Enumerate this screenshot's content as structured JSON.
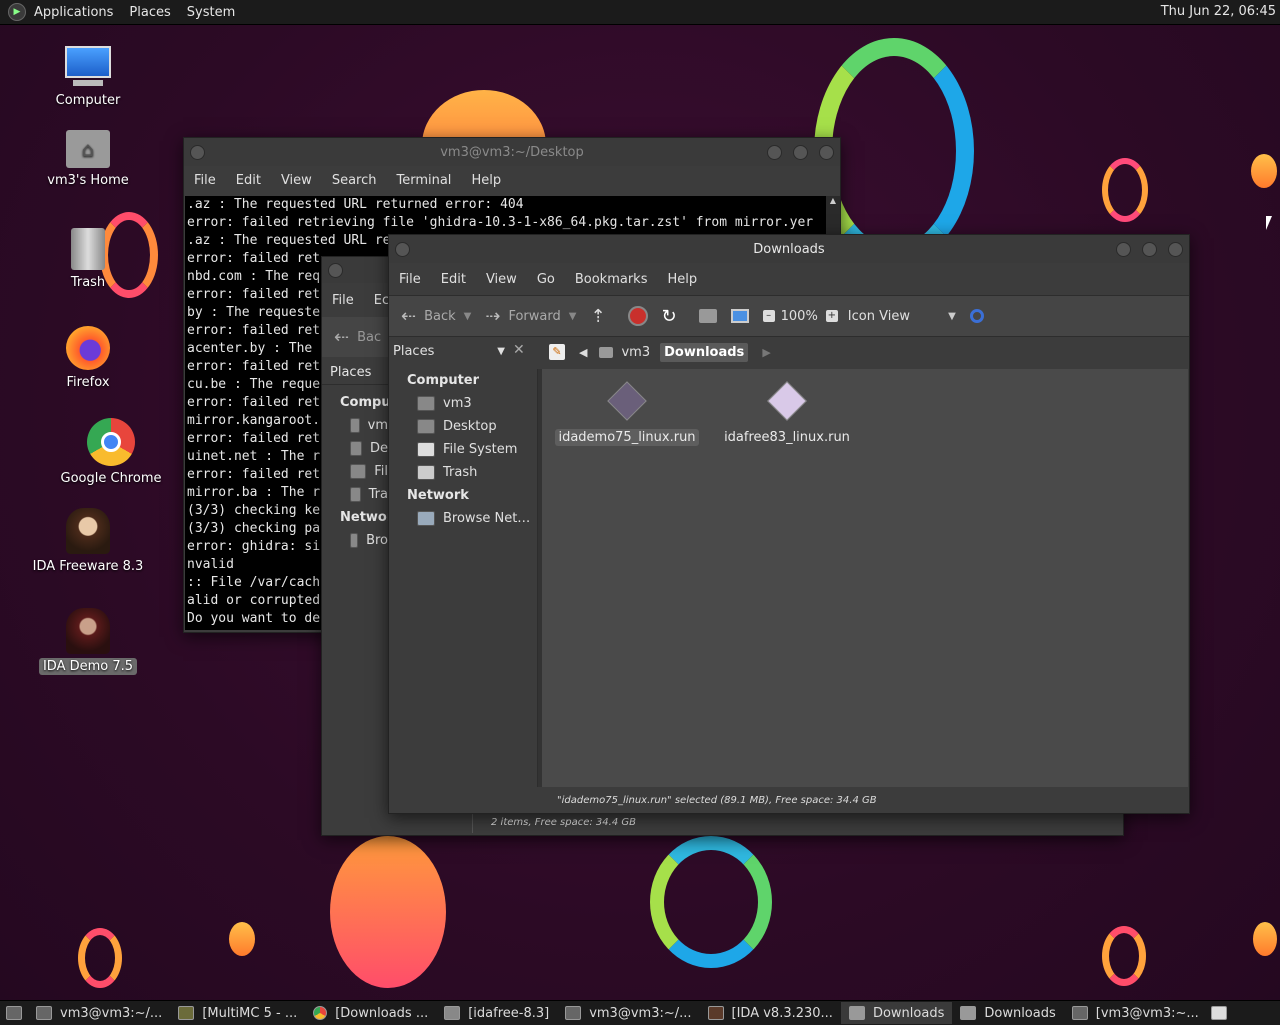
{
  "top_panel": {
    "menus": [
      "Applications",
      "Places",
      "System"
    ],
    "clock": "Thu Jun 22, 06:45"
  },
  "desktop_icons": [
    {
      "label": "Computer",
      "icon": "computer-icon"
    },
    {
      "label": "vm3's Home",
      "icon": "home-folder-icon"
    },
    {
      "label": "Trash",
      "icon": "trash-icon"
    },
    {
      "label": "Firefox",
      "icon": "firefox-icon"
    },
    {
      "label": "Google Chrome",
      "icon": "chrome-icon"
    },
    {
      "label": "IDA Freeware 8.3",
      "icon": "ida-freeware-icon"
    },
    {
      "label": "IDA Demo 7.5",
      "icon": "ida-demo-icon"
    }
  ],
  "terminal": {
    "title": "vm3@vm3:~/Desktop",
    "menus": [
      "File",
      "Edit",
      "View",
      "Search",
      "Terminal",
      "Help"
    ],
    "lines": [
      ".az : The requested URL returned error: 404",
      "error: failed retrieving file 'ghidra-10.3-1-x86_64.pkg.tar.zst' from mirror.yer",
      ".az : The requested URL re",
      "error: failed ret",
      "nbd.com : The req",
      "error: failed ret",
      "by : The requeste",
      "error: failed ret",
      "acenter.by : The",
      "error: failed ret",
      "cu.be : The reque",
      "error: failed ret",
      "mirror.kangaroot.",
      "error: failed ret",
      "uinet.net : The r",
      "error: failed ret",
      "mirror.ba : The r",
      "(3/3) checking ke",
      "(3/3) checking pa",
      "error: ghidra: si",
      "nvalid",
      ":: File /var/cach",
      "alid or corrupted",
      "Do you want to de"
    ]
  },
  "back_window": {
    "menus": [
      "File",
      "Ec"
    ],
    "back_label": "Bac",
    "places_label": "Places",
    "sidebar_items": [
      "Comput",
      "vm",
      "De",
      "Fil",
      "Tra",
      "Networ",
      "Bro"
    ],
    "status": "2 items, Free space: 34.4 GB"
  },
  "downloads": {
    "title": "Downloads",
    "menus": [
      "File",
      "Edit",
      "View",
      "Go",
      "Bookmarks",
      "Help"
    ],
    "toolbar": {
      "back": "Back",
      "forward": "Forward",
      "zoom": "100%",
      "view_mode": "Icon View"
    },
    "places_selector": "Places",
    "breadcrumb": [
      "vm3",
      "Downloads"
    ],
    "sidebar": {
      "computer_header": "Computer",
      "computer_items": [
        "vm3",
        "Desktop",
        "File System",
        "Trash"
      ],
      "network_header": "Network",
      "network_items": [
        "Browse Net…"
      ]
    },
    "files": [
      {
        "name": "idademo75_linux.run",
        "selected": true
      },
      {
        "name": "idafree83_linux.run",
        "selected": false
      }
    ],
    "status": "\"idademo75_linux.run\" selected (89.1 MB), Free space: 34.4 GB"
  },
  "taskbar": {
    "tasks": [
      "vm3@vm3:~/...",
      "[MultiMC 5 - ...",
      "[Downloads ...",
      "[idafree-8.3]",
      "vm3@vm3:~/...",
      "[IDA v8.3.230...",
      "Downloads",
      "Downloads",
      "[vm3@vm3:~..."
    ]
  }
}
